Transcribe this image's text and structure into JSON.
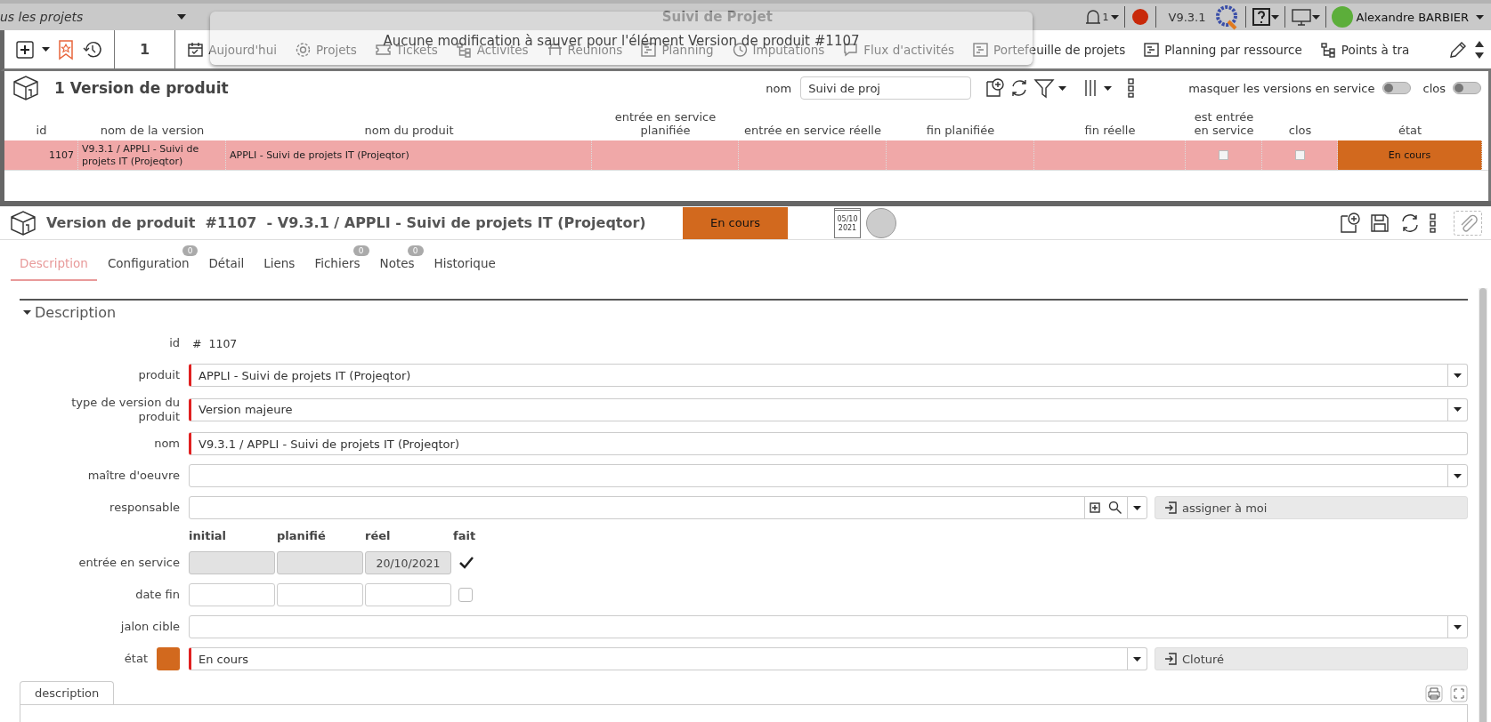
{
  "top_bar": {
    "project_selector": "us les projets",
    "app_title": "Suivi de Projet",
    "notifications_count": "1",
    "version": "V9.3.1",
    "user": "Alexandre BARBIER"
  },
  "toolbar": {
    "counter": "1",
    "items": [
      {
        "label": "Aujourd'hui"
      },
      {
        "label": "Projets"
      },
      {
        "label": "Tickets"
      },
      {
        "label": "Activités"
      },
      {
        "label": "Réunions"
      },
      {
        "label": "Planning"
      },
      {
        "label": "Imputations"
      },
      {
        "label": "Flux d'activités"
      },
      {
        "label": "Portefeuille de projets"
      },
      {
        "label": "Planning par ressource"
      },
      {
        "label": "Points à tra"
      }
    ]
  },
  "toast": {
    "message": "Aucune modification à sauver pour l'élément Version de produit #1107"
  },
  "list": {
    "title": "1 Version de produit",
    "filter_label": "nom",
    "filter_value": "Suivi de proj",
    "toggles": [
      {
        "label": "masquer les versions en service",
        "on": false
      },
      {
        "label": "clos",
        "on": false
      }
    ],
    "columns": [
      "id",
      "nom de la version",
      "nom du produit",
      "entrée en service planifiée",
      "entrée en service réelle",
      "fin planifiée",
      "fin réelle",
      "est entrée en service",
      "clos",
      "état"
    ],
    "rows": [
      {
        "id": "1107",
        "version": "V9.3.1 / APPLI - Suivi de projets IT (Projeqtor)",
        "product": "APPLI - Suivi de projets IT (Projeqtor)",
        "in_service": false,
        "closed": false,
        "status": "En cours",
        "color": "#d2691e",
        "selected": true
      }
    ]
  },
  "detail": {
    "title": "Version de produit  #1107  - V9.3.1 / APPLI - Suivi de projets IT (Projeqtor)",
    "status": "En cours",
    "date_badge": {
      "day": "05/10",
      "year": "2021"
    },
    "tabs": [
      {
        "label": "Description",
        "selected": true
      },
      {
        "label": "Configuration",
        "badge": "0",
        "selected": false
      },
      {
        "label": "Détail",
        "selected": false
      },
      {
        "label": "Liens",
        "selected": false
      },
      {
        "label": "Fichiers",
        "badge": "0",
        "selected": false
      },
      {
        "label": "Notes",
        "badge": "0",
        "selected": false
      },
      {
        "label": "Historique",
        "selected": false
      }
    ],
    "section": {
      "title": "Description",
      "expanded": true
    },
    "fields": [
      {
        "kind": "id",
        "label": "id",
        "prefix": "#",
        "value": "1107"
      },
      {
        "kind": "select",
        "label": "produit",
        "value": "APPLI - Suivi de projets IT (Projeqtor)",
        "required": true
      },
      {
        "kind": "select",
        "label": "type de version du produit",
        "value": "Version majeure",
        "required": true
      },
      {
        "kind": "text",
        "label": "nom",
        "value": "V9.3.1 / APPLI - Suivi de projets IT (Projeqtor)",
        "required": true
      },
      {
        "kind": "select",
        "label": "maître d'oeuvre",
        "required": false
      },
      {
        "kind": "user",
        "label": "responsable",
        "action": "assigner à moi"
      },
      {
        "kind": "date_headers",
        "headers": [
          "initial",
          "planifié",
          "réel",
          "fait"
        ]
      },
      {
        "kind": "dates",
        "label": "entrée en service",
        "readonly": true,
        "real": "20/10/2021",
        "done": true
      },
      {
        "kind": "dates",
        "label": "date fin",
        "readonly": false,
        "done": false
      },
      {
        "kind": "select",
        "label": "jalon cible",
        "required": false
      },
      {
        "kind": "status",
        "label": "état",
        "value": "En cours",
        "color": "#d2691e",
        "action": "Cloturé"
      }
    ],
    "editor": {
      "tab": "description"
    }
  }
}
